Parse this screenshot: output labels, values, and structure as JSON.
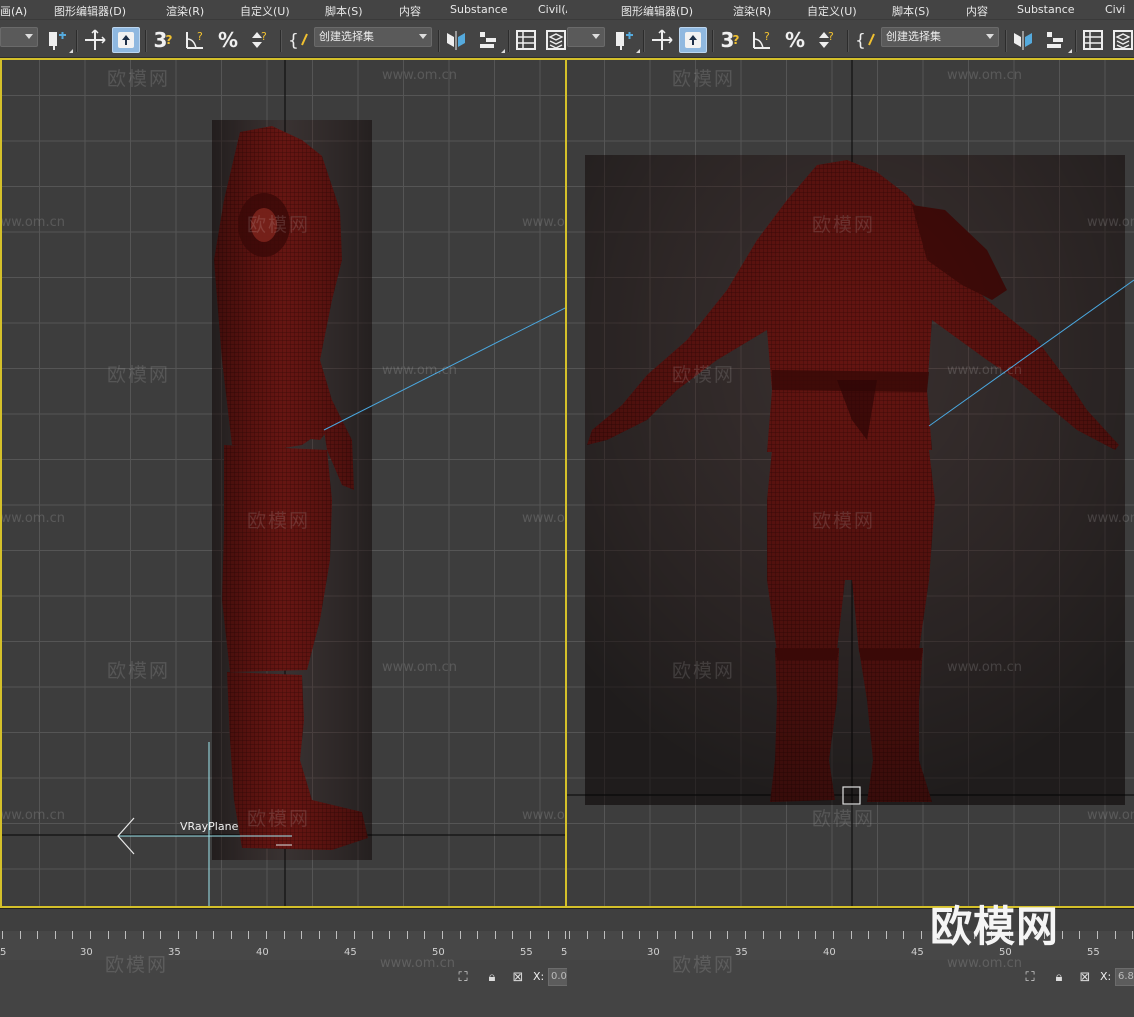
{
  "menus": [
    "画(A)",
    "图形编辑器(D)",
    "渲染(R)",
    "自定义(U)",
    "脚本(S)",
    "内容",
    "Substance",
    "Civil(A)"
  ],
  "right_menus": [
    "图形编辑器(D)",
    "渲染(R)",
    "自定义(U)",
    "脚本(S)",
    "内容",
    "Substance",
    "Civi"
  ],
  "toolbar": {
    "snap_3d": "3",
    "percent_snap": "%",
    "selection_set_placeholder": "创建选择集"
  },
  "viewport_left": {
    "object_label": "VRayPlane"
  },
  "watermark": {
    "text": "欧模网",
    "url": "www.om.cn"
  },
  "timeline": {
    "left_ticks": [
      "5",
      "30",
      "35",
      "40",
      "45",
      "50",
      "55",
      "5"
    ],
    "right_ticks": [
      "30",
      "35",
      "40",
      "45",
      "50",
      "55"
    ]
  },
  "status": {
    "x_label": "X:",
    "left_x_value": "0.0",
    "right_x_value": "6.8"
  },
  "logo": "欧模网",
  "colors": {
    "active_viewport_border": "#d4c02a",
    "model_red": "#6e1a16",
    "model_highlight": "#a8342c",
    "active_tool": "#8fb8e0",
    "grid_line": "#555555",
    "axis_line": "#111111",
    "link_line": "#4aa8e0"
  }
}
